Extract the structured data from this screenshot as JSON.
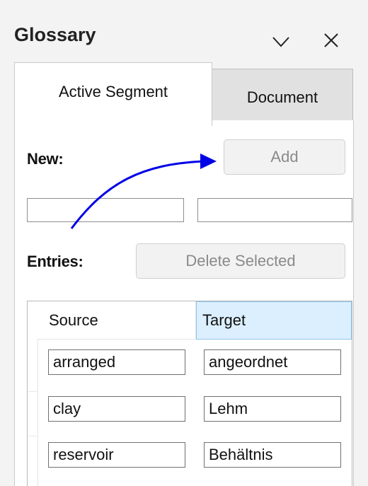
{
  "window": {
    "title": "Glossary"
  },
  "tabs": [
    {
      "label": "Active Segment",
      "active": true
    },
    {
      "label": "Document",
      "active": false
    }
  ],
  "new_section": {
    "label": "New:",
    "add_button": "Add",
    "source_value": "",
    "target_value": ""
  },
  "entries_section": {
    "label": "Entries:",
    "delete_button": "Delete Selected"
  },
  "table": {
    "columns": [
      "Source",
      "Target"
    ],
    "rows": [
      {
        "source": "arranged",
        "target": "angeordnet"
      },
      {
        "source": "clay",
        "target": "Lehm"
      },
      {
        "source": "reservoir",
        "target": "Behältnis"
      }
    ]
  },
  "colors": {
    "arrow": "#0000e6",
    "selected_header": "#dcefff"
  },
  "icons": [
    "chevron-down-icon",
    "close-icon"
  ]
}
